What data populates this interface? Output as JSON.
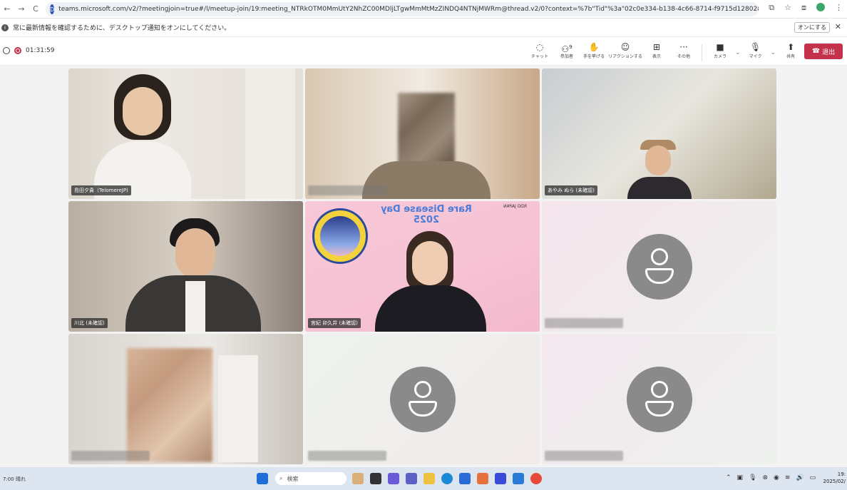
{
  "browser": {
    "back": "←",
    "forward": "→",
    "reload": "C",
    "site_badge": "D",
    "url": "teams.microsoft.com/v2/?meetingjoin=true#/l/meetup-join/19:meeting_NTRkOTM0MmUtY2NhZC00MDljLTgwMmMtMzZINDQ4NTNjMWRm@thread.v2/0?context=%7b\"Tid\"%3a\"02c0e334-b138-4c66-8714-f9715d128028\"%2c\"Oid\"..."
  },
  "notification": {
    "icon": "i",
    "text": "常に最新情報を確認するために、デスクトップ通知をオンにしてください。",
    "button": "オンにする",
    "close": "✕"
  },
  "meeting": {
    "timer": "01:31:59",
    "participant_count": "9",
    "tools": [
      {
        "icon": "chat-icon",
        "glyph": "◌",
        "label": "チャット"
      },
      {
        "icon": "people-icon",
        "glyph": "⚇",
        "label": "参加者"
      },
      {
        "icon": "raise-hand-icon",
        "glyph": "✋",
        "label": "手を挙げる"
      },
      {
        "icon": "reaction-icon",
        "glyph": "☺",
        "label": "リアクションする"
      },
      {
        "icon": "view-icon",
        "glyph": "⊞",
        "label": "表示"
      },
      {
        "icon": "more-icon",
        "glyph": "···",
        "label": "その他"
      }
    ],
    "camera_label": "カメラ",
    "mic_label": "マイク",
    "share_label": "共有",
    "leave_label": "退出"
  },
  "participants": [
    {
      "name": "島田夕貴（TelomereJP)",
      "video": true
    },
    {
      "name": "",
      "video": true
    },
    {
      "name": "あやみ ぬら (未確認)",
      "video": true
    },
    {
      "name": "川北 (未確認)",
      "video": true
    },
    {
      "name": "宮紀 卯久井 (未確認)",
      "video": true,
      "banner": "Rare Disease Day 2025",
      "org": "RDD JAPAN"
    },
    {
      "name": "",
      "video": false
    },
    {
      "name": "",
      "video": true
    },
    {
      "name": "",
      "video": false
    },
    {
      "name": "",
      "video": false
    }
  ],
  "taskbar": {
    "weather": "7:00 晴れ",
    "search": "検索",
    "clock_time": "19:",
    "clock_date": "2025/02/"
  },
  "colors": {
    "leave": "#c4314b",
    "avatar": "#8a8a8a",
    "brand": "#2e4fb3"
  }
}
